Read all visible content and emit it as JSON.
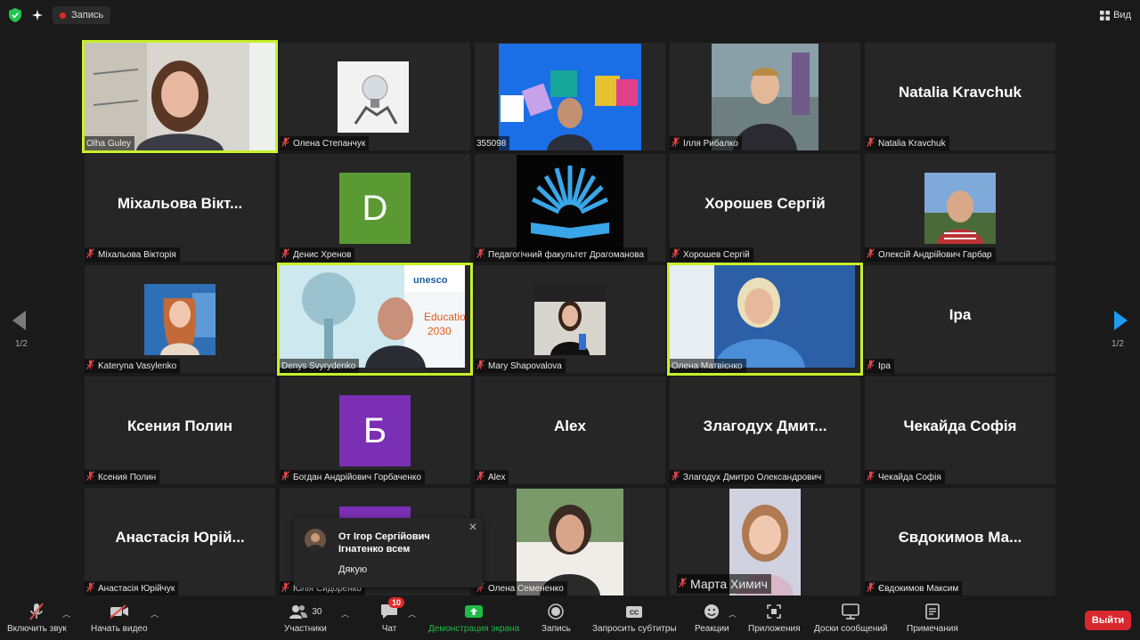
{
  "topbar": {
    "record_label": "Запись",
    "view_label": "Вид"
  },
  "nav": {
    "page_indicator_left": "1/2",
    "page_indicator_right": "1/2"
  },
  "tiles": [
    {
      "label": "Olha Guley",
      "muted": false,
      "kind": "video-woman",
      "active": true
    },
    {
      "label": "Олена Степанчук",
      "muted": true,
      "kind": "image-bulb"
    },
    {
      "label": "355098",
      "muted": false,
      "kind": "video-blue"
    },
    {
      "label": "Ілля Рибалко",
      "muted": true,
      "kind": "photo-man"
    },
    {
      "label": "Natalia Kravchuk",
      "muted": true,
      "kind": "name",
      "big": "Natalia Kravchuk"
    },
    {
      "label": "Міхальова Вікторія",
      "muted": true,
      "kind": "name",
      "big": "Міхальова Вікт..."
    },
    {
      "label": "Денис Хренов",
      "muted": true,
      "kind": "avatar",
      "letter": "D",
      "color": "#5b9a33"
    },
    {
      "label": "Педагогічний факультет Драгоманова",
      "muted": true,
      "kind": "logo-book"
    },
    {
      "label": "Хорошев Сергій",
      "muted": true,
      "kind": "name",
      "big": "Хорошев Сергій"
    },
    {
      "label": "Олексій Андрійович Гарбар",
      "muted": true,
      "kind": "photo-man2"
    },
    {
      "label": "Kateryna Vasylenko",
      "muted": true,
      "kind": "photo-woman2"
    },
    {
      "label": "Denys Svyrydenko",
      "muted": false,
      "kind": "video-unesco",
      "active": true
    },
    {
      "label": "Mary Shapovalova",
      "muted": true,
      "kind": "photo-woman3"
    },
    {
      "label": "Олена Матвієнко",
      "muted": false,
      "kind": "video-woman2",
      "active": true
    },
    {
      "label": "Іра",
      "muted": true,
      "kind": "name",
      "big": "Іра"
    },
    {
      "label": "Ксения Полин",
      "muted": true,
      "kind": "name",
      "big": "Ксения Полин"
    },
    {
      "label": "Богдан Андрійович Горбаченко",
      "muted": true,
      "kind": "avatar",
      "letter": "Б",
      "color": "#7b2fb5"
    },
    {
      "label": "Alex",
      "muted": true,
      "kind": "name",
      "big": "Alex"
    },
    {
      "label": "Злагодух Дмитро Олександрович",
      "muted": true,
      "kind": "name",
      "big": "Злагодух Дмит..."
    },
    {
      "label": "Чекайда Софія",
      "muted": true,
      "kind": "name",
      "big": "Чекайда Софія"
    },
    {
      "label": "Анастасія Юрійчук",
      "muted": true,
      "kind": "name",
      "big": "Анастасія Юрій..."
    },
    {
      "label": "Юлія Сидоренко",
      "muted": true,
      "kind": "avatar-partial",
      "color": "#7b2fb5"
    },
    {
      "label": "Олена Семененко",
      "muted": true,
      "kind": "photo-woman4"
    },
    {
      "label": "Марта Химич",
      "muted": true,
      "kind": "photo-woman5",
      "large_label": true
    },
    {
      "label": "Євдокимов Максим",
      "muted": true,
      "kind": "name",
      "big": "Євдокимов Ма..."
    }
  ],
  "chat_notification": {
    "sender": "От Ігор Сергійович Ігнатенко всем",
    "message": "Дякую"
  },
  "toolbar": {
    "unmute": "Включить звук",
    "video": "Начать видео",
    "participants": "Участники",
    "participants_count": "30",
    "chat": "Чат",
    "chat_badge": "10",
    "share": "Демонстрация экрана",
    "record": "Запись",
    "captions": "Запросить субтитры",
    "reactions": "Реакции",
    "apps": "Приложения",
    "whiteboards": "Доски сообщений",
    "notes": "Примечания",
    "leave": "Выйти"
  },
  "colors": {
    "active_border": "#c8f02a",
    "share_green": "#1fba47",
    "leave_red": "#d9272e",
    "muted_red": "#e0484c"
  }
}
